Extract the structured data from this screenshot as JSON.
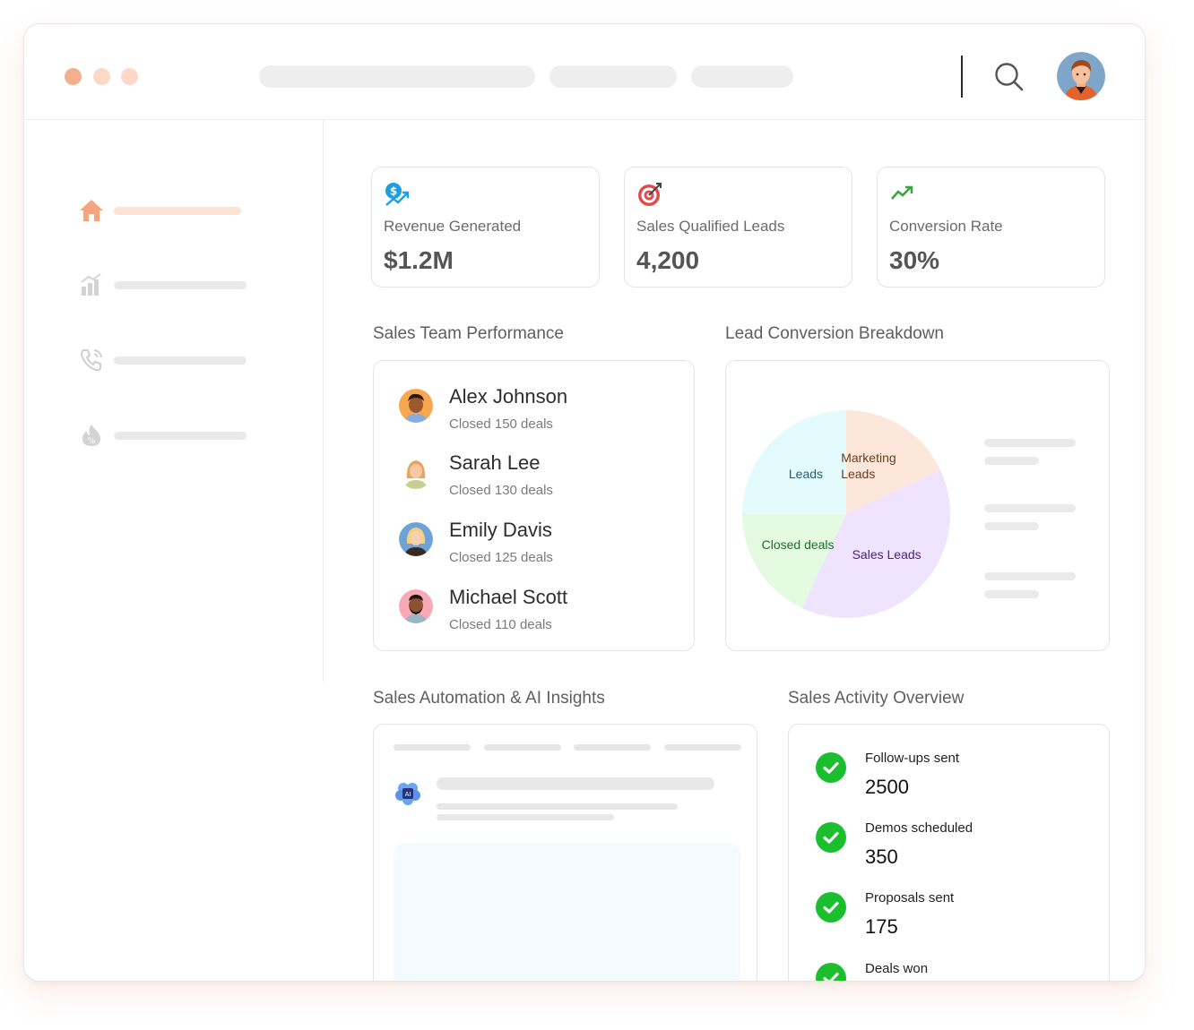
{
  "colors": {
    "accent": "#f4a57e",
    "success": "#1bbf2d",
    "pie_leads": "#e3fbfd",
    "pie_marketing": "#fde6da",
    "pie_sales": "#efe3fd",
    "pie_closed": "#e4fbe2"
  },
  "window_controls": [
    "dot-orange",
    "dot-orange-light",
    "dot-orange-light"
  ],
  "sidebar": {
    "items": [
      {
        "icon": "home-icon",
        "active": true
      },
      {
        "icon": "bar-chart-icon",
        "active": false
      },
      {
        "icon": "phone-icon",
        "active": false
      },
      {
        "icon": "discount-flame-icon",
        "active": false
      }
    ]
  },
  "kpis": [
    {
      "icon": "revenue-icon",
      "label": "Revenue Generated",
      "value": "$1.2M"
    },
    {
      "icon": "target-icon",
      "label": "Sales Qualified Leads",
      "value": "4,200"
    },
    {
      "icon": "trend-up-icon",
      "label": "Conversion Rate",
      "value": "30%"
    }
  ],
  "team": {
    "title": "Sales Team Performance",
    "members": [
      {
        "name": "Alex Johnson",
        "deals": "Closed 150 deals"
      },
      {
        "name": "Sarah Lee",
        "deals": "Closed 130 deals"
      },
      {
        "name": "Emily Davis",
        "deals": "Closed 125 deals"
      },
      {
        "name": "Michael Scott",
        "deals": "Closed 110 deals"
      }
    ]
  },
  "breakdown": {
    "title": "Lead Conversion Breakdown"
  },
  "chart_data": {
    "type": "pie",
    "title": "Lead Conversion Breakdown",
    "slices": [
      {
        "label": "Marketing Leads",
        "value": 18,
        "color": "#fde6da"
      },
      {
        "label": "Sales Leads",
        "value": 39,
        "color": "#efe3fd"
      },
      {
        "label": "Closed deals",
        "value": 18,
        "color": "#e4fbe2"
      },
      {
        "label": "Leads",
        "value": 25,
        "color": "#e3fbfd"
      }
    ]
  },
  "ai": {
    "title": "Sales Automation & AI Insights",
    "badge": "AI"
  },
  "activity": {
    "title": "Sales Activity Overview",
    "items": [
      {
        "label": "Follow-ups sent",
        "value": "2500"
      },
      {
        "label": "Demos scheduled",
        "value": "350"
      },
      {
        "label": "Proposals sent",
        "value": "175"
      },
      {
        "label": "Deals won",
        "value": ""
      }
    ]
  }
}
